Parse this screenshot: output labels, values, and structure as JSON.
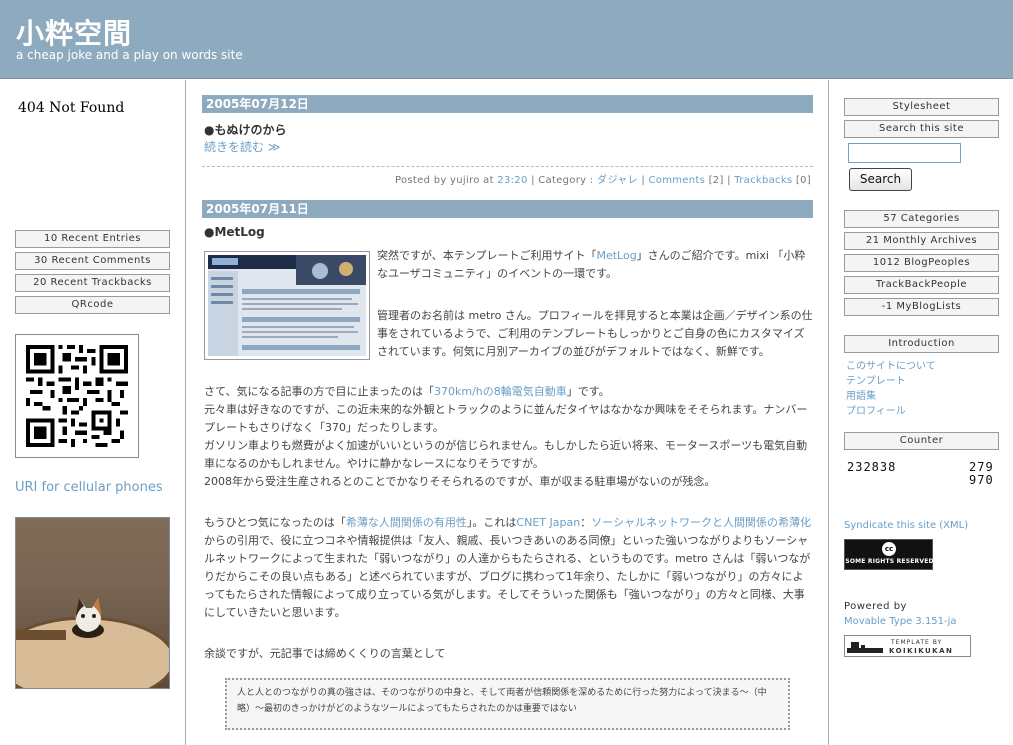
{
  "site": {
    "title": "小粋空間",
    "subtitle": "a cheap joke and a play on words site"
  },
  "left": {
    "notfound": "404 Not Found",
    "menu": [
      "10  Recent Entries",
      "30  Recent Comments",
      "20  Recent Trackbacks",
      "QRcode"
    ],
    "cellular_link": "URI for cellular phones"
  },
  "entries": [
    {
      "date": "2005年07月12日",
      "title": "●もぬけのから",
      "more": "続きを読む ≫",
      "footer": {
        "posted_by": "Posted by yujiro at ",
        "time": "23:20",
        "category_label": " | Category : ",
        "category": "ダジャレ",
        "comments": "Comments",
        "comments_count": " [2] | ",
        "trackbacks": "Trackbacks",
        "trackbacks_count": " [0]"
      }
    },
    {
      "date": "2005年07月11日",
      "title": "●MetLog",
      "p1_a": "突然ですが、本テンプレートご利用サイト「",
      "p1_link": "MetLog",
      "p1_b": "」さんのご紹介です。mixi 「小粋なユーザコミュニティ」のイベントの一環です。",
      "p2": "管理者のお名前は metro さん。プロフィールを拝見すると本業は企画／デザイン系の仕事をされているようで、ご利用のテンプレートもしっかりとご自身の色にカスタマイズされています。何気に月別アーカイブの並びがデフォルトではなく、新鮮です。",
      "p3_a": "さて、気になる記事の方で目に止まったのは「",
      "p3_link": "370km/hの8輪電気自動車",
      "p3_b": "」です。",
      "p3_c": "元々車は好きなのですが、この近未来的な外観とトラックのように並んだタイヤはなかなか興味をそそられます。ナンバープレートもさりげなく「370」だったりします。",
      "p3_d": "ガソリン車よりも燃費がよく加速がいいというのが信じられません。もしかしたら近い将来、モータースポーツも電気自動車になるのかもしれません。やけに静かなレースになりそうですが。",
      "p3_e": "2008年から受注生産されるとのことでかなりそそられるのですが、車が収まる駐車場がないのが残念。",
      "p4_a": "もうひとつ気になったのは「",
      "p4_link1": "希薄な人間関係の有用性",
      "p4_b": "」。これは",
      "p4_link2": "CNET Japan",
      "p4_c": "：",
      "p4_link3": "ソーシャルネットワークと人間関係の希薄化",
      "p4_d": "からの引用で、役に立つコネや情報提供は「友人、親戚、長いつきあいのある同僚」といった強いつながりよりもソーシャルネットワークによって生まれた「弱いつながり」の人達からもたらされる、というものです。metro さんは「弱いつながりだからこその良い点もある」と述べられていますが、ブログに携わって1年余り、たしかに「弱いつながり」の方々によってもたらされた情報によって成り立っている気がします。そしてそういった関係も「強いつながり」の方々と同様、大事にしていきたいと思います。",
      "p5": "余談ですが、元記事では締めくくりの言葉として",
      "quote": "人と人とのつながりの真の強さは、そのつながりの中身と、そして両者が信頼関係を深めるために行った努力によって決まる〜（中略）〜最初のきっかけがどのようなツールによってもたらされたのかは重要ではない"
    }
  ],
  "right": {
    "stylesheet": "Stylesheet",
    "search_label": "Search this site",
    "search_value": "",
    "search_button": "Search",
    "stats": [
      "57  Categories",
      "21  Monthly Archives",
      "1012  BlogPeoples",
      "TrackBackPeople",
      "-1  MyBlogLists"
    ],
    "intro_label": "Introduction",
    "intro_links": [
      "このサイトについて",
      "テンプレート",
      "用語集",
      "プロフィール"
    ],
    "counter_label": "Counter",
    "counter_total": "232838",
    "counter_today": "279",
    "counter_yesterday": "970",
    "syndicate": "Syndicate this site (XML)",
    "cc_text": "SOME RIGHTS RESERVED",
    "cc_symbol": "cc",
    "powered_label": "Powered by",
    "mt_link": "Movable Type 3.151-ja",
    "template_by_small": "TEMPLATE BY",
    "template_by_name": "KOIKIKUKAN"
  }
}
